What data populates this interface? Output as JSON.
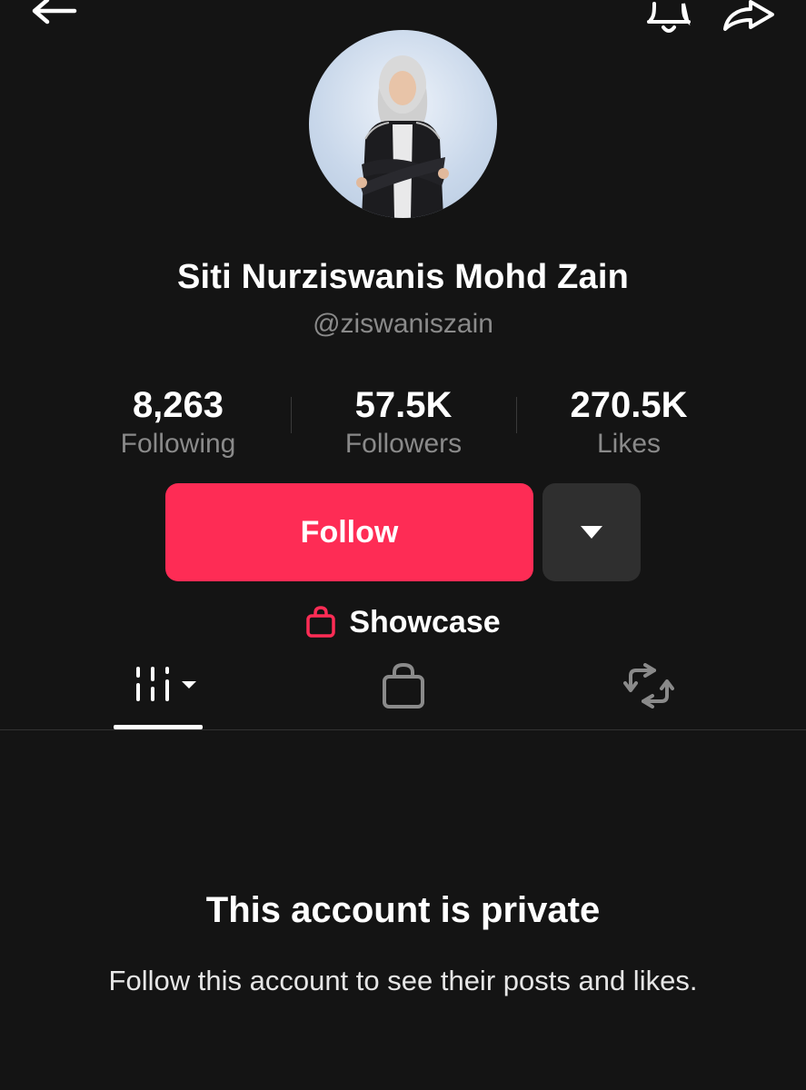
{
  "header": {
    "back_icon": "arrow-left-icon",
    "notification_icon": "bell-icon",
    "share_icon": "share-arrow-icon"
  },
  "profile": {
    "display_name": "Siti Nurziswanis Mohd Zain",
    "username": "@ziswaniszain"
  },
  "stats": [
    {
      "value": "8,263",
      "label": "Following"
    },
    {
      "value": "57.5K",
      "label": "Followers"
    },
    {
      "value": "270.5K",
      "label": "Likes"
    }
  ],
  "actions": {
    "follow_label": "Follow",
    "more_icon": "caret-down-icon"
  },
  "showcase": {
    "label": "Showcase",
    "icon": "shopping-bag-icon"
  },
  "tabs": [
    {
      "icon": "videos-grid-icon",
      "active": true
    },
    {
      "icon": "shopping-bag-icon",
      "active": false
    },
    {
      "icon": "repost-icon",
      "active": false
    }
  ],
  "private_notice": {
    "title": "This account is private",
    "subtitle": "Follow this account to see their posts and likes."
  },
  "colors": {
    "background": "#141414",
    "follow_button": "#fe2c55",
    "secondary_button": "#2f2f2f",
    "muted_text": "#8a8a8a",
    "accent_icon": "#fe2c55"
  }
}
